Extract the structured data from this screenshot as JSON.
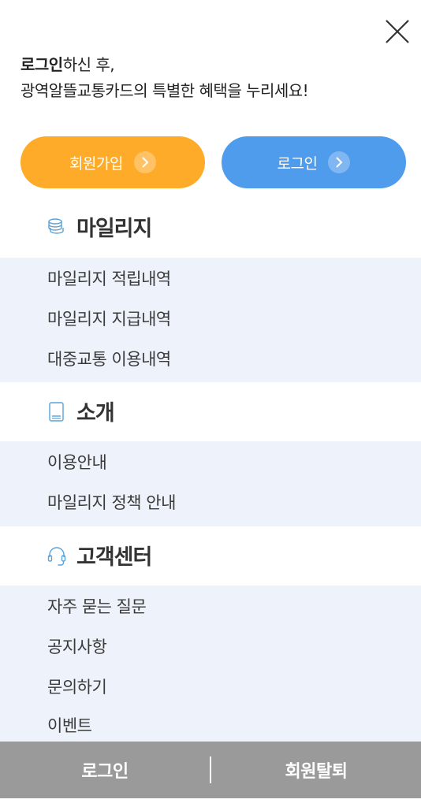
{
  "intro": {
    "bold": "로그인",
    "rest": "하신 후,",
    "line2": "광역알뜰교통카드의 특별한 혜택을 누리세요!"
  },
  "buttons": {
    "join": "회원가입",
    "login": "로그인"
  },
  "sections": [
    {
      "title": "마일리지",
      "icon": "coins-icon",
      "items": [
        "마일리지 적립내역",
        "마일리지 지급내역",
        "대중교통 이용내역"
      ]
    },
    {
      "title": "소개",
      "icon": "book-icon",
      "items": [
        "이용안내",
        "마일리지 정책 안내"
      ]
    },
    {
      "title": "고객센터",
      "icon": "headset-icon",
      "items": [
        "자주 묻는 질문",
        "공지사항",
        "문의하기",
        "이벤트"
      ]
    }
  ],
  "footer": {
    "login": "로그인",
    "withdraw": "회원탈퇴"
  },
  "colors": {
    "join": "#ffab2a",
    "login": "#4f9ced",
    "panel": "#eef3fb",
    "footer": "#9a9a9a",
    "icon": "#5aa3d9"
  }
}
